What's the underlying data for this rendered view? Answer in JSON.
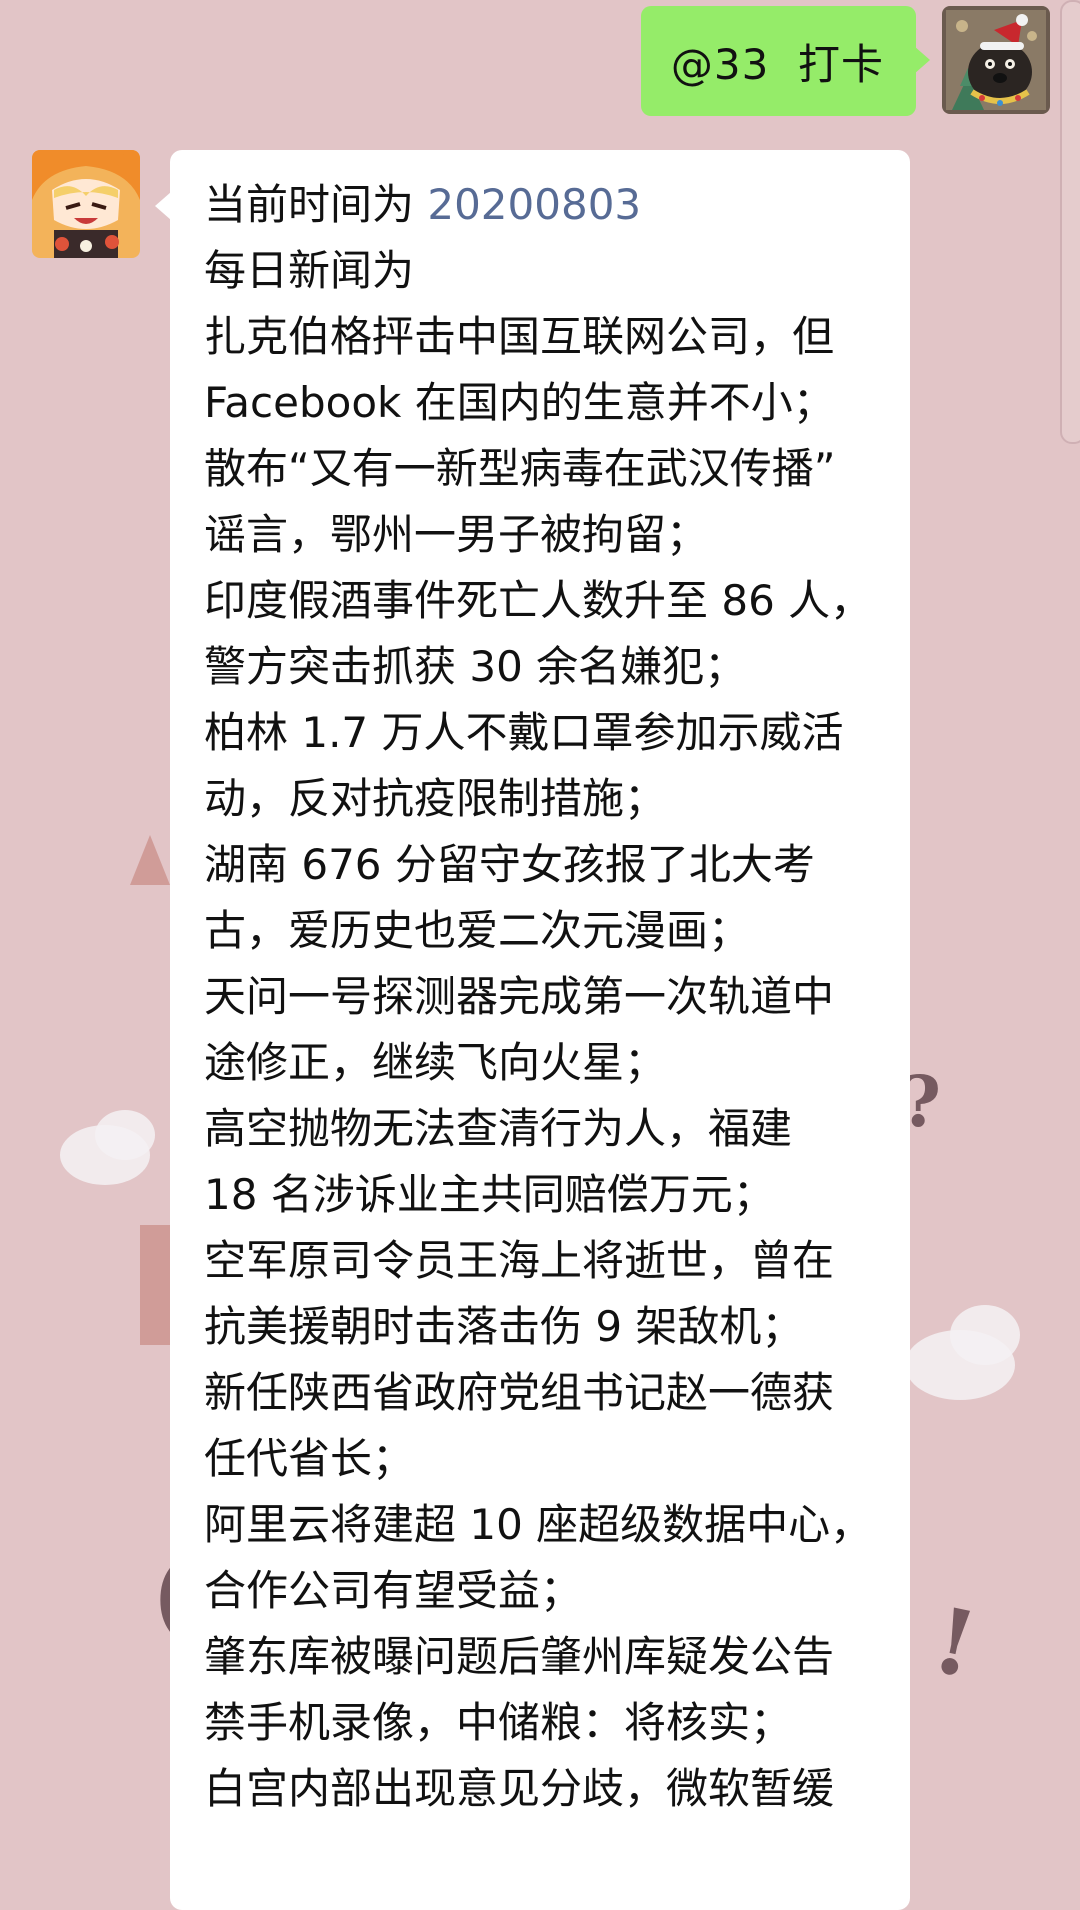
{
  "sent_message": {
    "text": "@33  打卡"
  },
  "received_message": {
    "time_prefix": "当前时间为 ",
    "date": "20200803",
    "lines": [
      "每日新闻为",
      "扎克伯格抨击中国互联网公司，但",
      "Facebook 在国内的生意并不小；",
      "散布“又有一新型病毒在武汉传播”",
      "谣言，鄂州一男子被拘留；",
      "印度假酒事件死亡人数升至 86 人，",
      "警方突击抓获 30 余名嫌犯；",
      "柏林 1.7 万人不戴口罩参加示威活",
      "动，反对抗疫限制措施；",
      "湖南 676 分留守女孩报了北大考",
      "古，爱历史也爱二次元漫画；",
      "天问一号探测器完成第一次轨道中",
      "途修正，继续飞向火星；",
      "高空抛物无法查清行为人，福建",
      "18 名涉诉业主共同赔偿万元；",
      "空军原司令员王海上将逝世，曾在",
      "抗美援朝时击落击伤 9 架敌机；",
      "新任陕西省政府党组书记赵一德获",
      "任代省长；",
      "阿里云将建超 10 座超级数据中心，",
      "合作公司有望受益；",
      "肇东库被曝问题后肇州库疑发公告",
      "禁手机录像，中储粮：将核实；",
      "白宫内部出现意见分歧，微软暂缓"
    ]
  },
  "avatars": {
    "self": "dog-christmas-avatar",
    "other": "anime-girl-avatar"
  },
  "colors": {
    "background": "#e2c5c7",
    "sent_bubble": "#95ec69",
    "received_bubble": "#ffffff",
    "link": "#576b95"
  }
}
